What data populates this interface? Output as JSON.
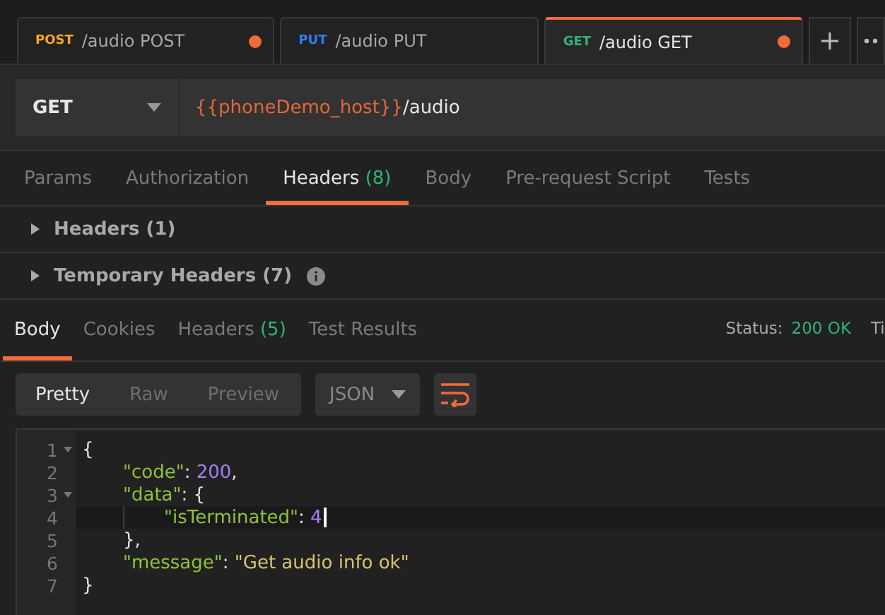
{
  "tabs": [
    {
      "method": "POST",
      "color": "#f5a623",
      "title": "/audio POST",
      "unsaved": true,
      "selected": false
    },
    {
      "method": "PUT",
      "color": "#2f7ff0",
      "title": "/audio PUT",
      "unsaved": false,
      "selected": false
    },
    {
      "method": "GET",
      "color": "#2fb57a",
      "title": "/audio GET",
      "unsaved": true,
      "selected": true
    }
  ],
  "request": {
    "method": "GET",
    "url_variable": "{{phoneDemo_host}}",
    "url_path": "/audio"
  },
  "request_tabs": [
    {
      "label": "Params",
      "selected": false
    },
    {
      "label": "Authorization",
      "selected": false
    },
    {
      "label": "Headers",
      "count": "(8)",
      "selected": true
    },
    {
      "label": "Body",
      "selected": false
    },
    {
      "label": "Pre-request Script",
      "selected": false
    },
    {
      "label": "Tests",
      "selected": false
    }
  ],
  "header_groups": [
    {
      "label": "Headers",
      "count": "(1)",
      "expanded": false,
      "info": false
    },
    {
      "label": "Temporary Headers",
      "count": "(7)",
      "expanded": false,
      "info": true
    }
  ],
  "response_tabs": [
    {
      "label": "Body",
      "selected": true
    },
    {
      "label": "Cookies",
      "selected": false
    },
    {
      "label": "Headers",
      "count": "(5)",
      "selected": false
    },
    {
      "label": "Test Results",
      "selected": false
    }
  ],
  "status": {
    "label": "Status:",
    "value": "200 OK",
    "cut_label": "Ti"
  },
  "view_modes": [
    {
      "label": "Pretty",
      "selected": true
    },
    {
      "label": "Raw",
      "selected": false
    },
    {
      "label": "Preview",
      "selected": false
    }
  ],
  "format": "JSON",
  "editor": {
    "lines": [
      {
        "number": "1",
        "foldable": true,
        "current": false,
        "tokens": [
          {
            "kind": "punct",
            "text": "{"
          }
        ]
      },
      {
        "number": "2",
        "foldable": false,
        "current": false,
        "tokens": [
          {
            "kind": "key",
            "text": "\"code\""
          },
          {
            "kind": "punct",
            "text": ": "
          },
          {
            "kind": "number",
            "text": "200"
          },
          {
            "kind": "punct",
            "text": ","
          }
        ]
      },
      {
        "number": "3",
        "foldable": true,
        "current": false,
        "tokens": [
          {
            "kind": "key",
            "text": "\"data\""
          },
          {
            "kind": "punct",
            "text": ": {"
          }
        ]
      },
      {
        "number": "4",
        "foldable": false,
        "current": true,
        "tokens": [
          {
            "kind": "key",
            "text": "\"isTerminated\""
          },
          {
            "kind": "punct",
            "text": ": "
          },
          {
            "kind": "number",
            "text": "4"
          }
        ]
      },
      {
        "number": "5",
        "foldable": false,
        "current": false,
        "tokens": [
          {
            "kind": "punct",
            "text": "},"
          }
        ]
      },
      {
        "number": "6",
        "foldable": false,
        "current": false,
        "tokens": [
          {
            "kind": "key",
            "text": "\"message\""
          },
          {
            "kind": "punct",
            "text": ": "
          },
          {
            "kind": "string",
            "text": "\"Get audio info ok\""
          }
        ]
      },
      {
        "number": "7",
        "foldable": false,
        "current": false,
        "tokens": [
          {
            "kind": "punct",
            "text": "}"
          }
        ]
      }
    ]
  }
}
